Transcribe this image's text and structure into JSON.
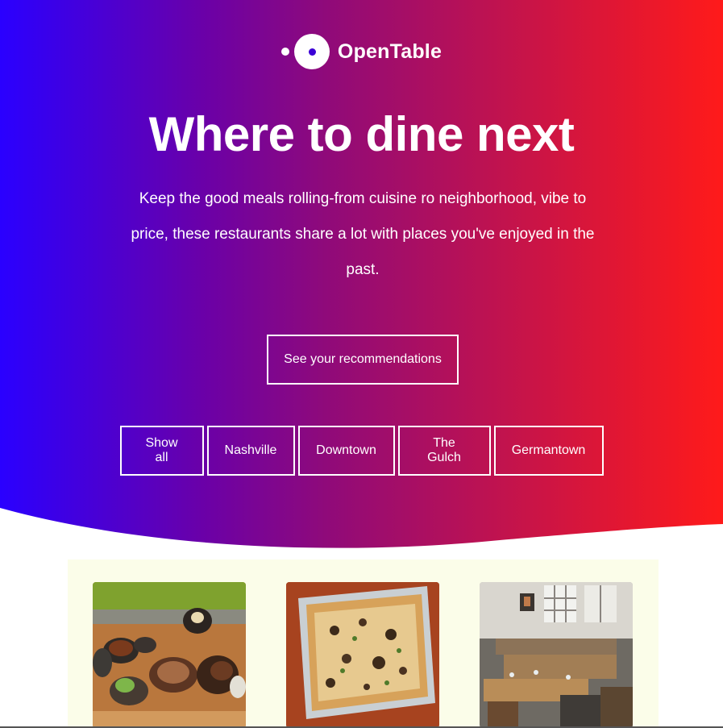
{
  "brand": {
    "name": "OpenTable",
    "logo_icon": "opentable-logo-icon",
    "gradient_start": "#2a00ff",
    "gradient_end": "#ff1a1a"
  },
  "hero": {
    "headline": "Where to dine next",
    "subhead": "Keep the good meals rolling-from cuisine ro neighborhood, vibe to price, these restaurants share a lot with places you've enjoyed in the past.",
    "cta_label": "See your recommendations"
  },
  "filters": [
    {
      "label": "Show all"
    },
    {
      "label": "Nashville"
    },
    {
      "label": "Downtown"
    },
    {
      "label": "The Gulch"
    },
    {
      "label": "Germantown"
    }
  ],
  "cards": [
    {
      "image": "grilled-meat-platter-photo"
    },
    {
      "image": "pizza-photo"
    },
    {
      "image": "restaurant-dining-room-photo"
    }
  ]
}
